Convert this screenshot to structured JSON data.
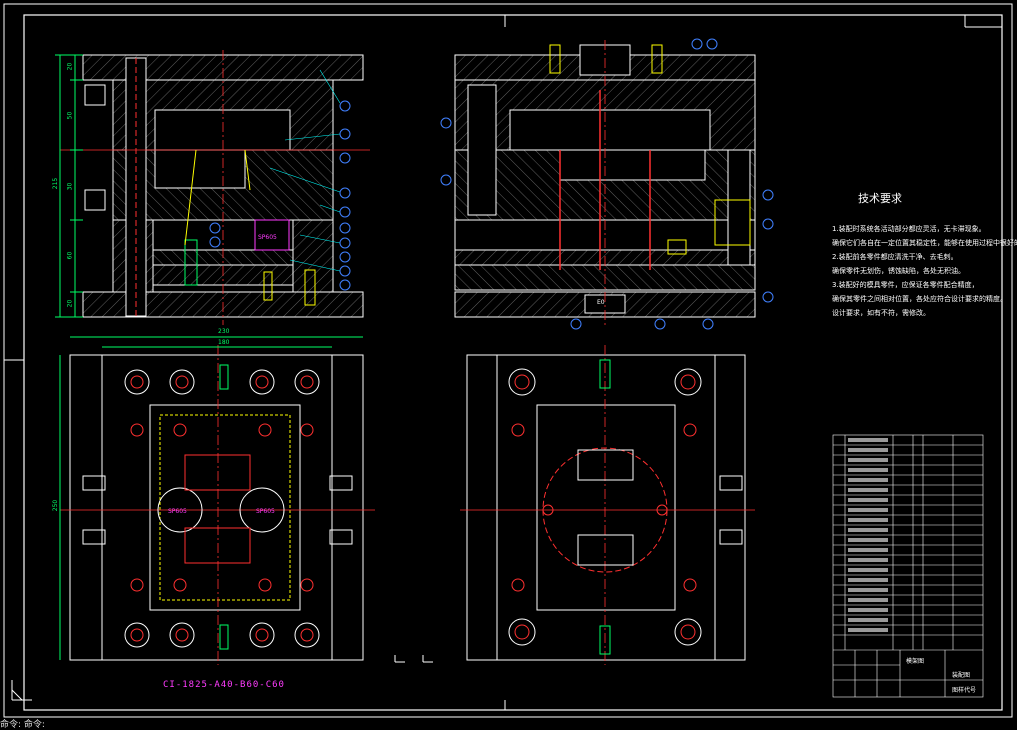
{
  "drawing": {
    "tech_title": "技术要求",
    "tech_lines": [
      "1.装配时系统各活动部分都应灵活，无卡滞现象。",
      "确保它们各自在一定位置其稳定性，能够在使用过程中很好的。",
      "2.装配前各零件都应清洗干净、去毛刺。",
      "确保零件无划伤，锈蚀缺陷，各处无积油。",
      "3.装配好的模具零件，应保证各零件配合精度，",
      "确保其零件之间相对位置，各处应符合设计要求的精度。",
      "设计要求，如有不符，需修改。"
    ],
    "part_number": "CI-1825-A40-B60-C60",
    "dims": {
      "overall_h": "215",
      "w1": "230",
      "w2": "180",
      "h_plan": "250",
      "d20a": "20",
      "d30": "30",
      "d60": "60",
      "d20b": "20",
      "d50": "50"
    },
    "labels": {
      "sprue1": "SP605",
      "sprue2": "SP605",
      "sprue3": "SP605",
      "ejector_box": "E0"
    },
    "title_block": {
      "name1": "模架图",
      "name2": "装配图",
      "name3": "图样代号"
    },
    "status_bar": "命令: 命令:"
  }
}
